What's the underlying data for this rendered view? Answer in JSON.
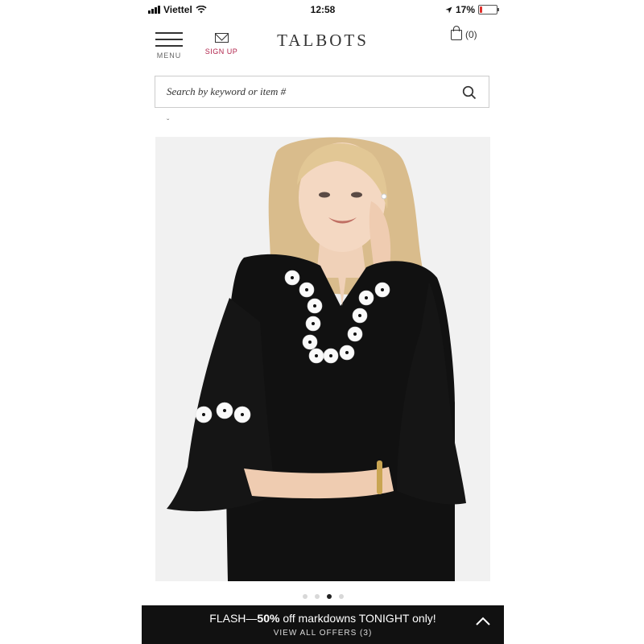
{
  "status_bar": {
    "carrier": "Viettel",
    "time": "12:58",
    "battery_percent": "17%",
    "battery_level": 0.17
  },
  "header": {
    "menu_label": "MENU",
    "signup_label": "SIGN UP",
    "logo": "TALBOTS",
    "cart_count": "(0)"
  },
  "search": {
    "placeholder": "Search by keyword or item #"
  },
  "carousel": {
    "total": 4,
    "active_index": 2
  },
  "banner": {
    "promo_prefix": "FLASH—",
    "promo_highlight": "50%",
    "promo_suffix": " off markdowns TONIGHT only!",
    "offers_label": "VIEW ALL OFFERS",
    "offers_count": "(3)"
  },
  "colors": {
    "accent": "#b0224a",
    "banner_bg": "#111111",
    "battery_low": "#e0302b"
  }
}
